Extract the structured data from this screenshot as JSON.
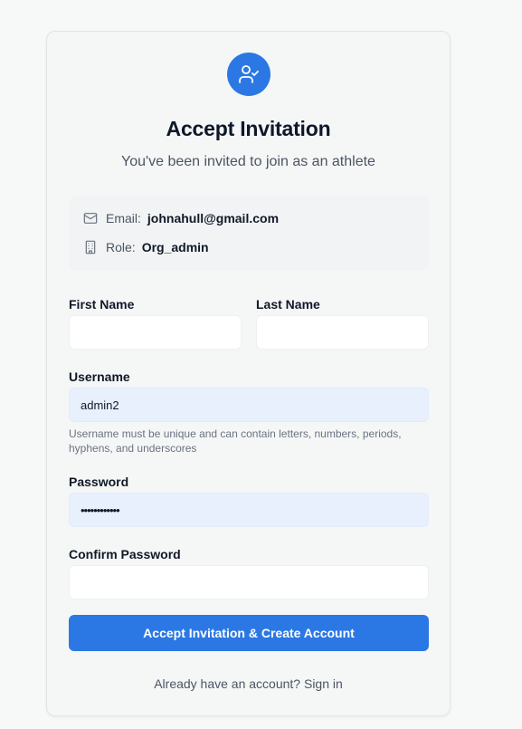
{
  "header": {
    "icon": "user-check-icon",
    "title": "Accept Invitation",
    "subtitle": "You've been invited to join as an athlete"
  },
  "invite_info": {
    "email_label": "Email:",
    "email_value": "johnahull@gmail.com",
    "email_icon": "mail-icon",
    "role_label": "Role:",
    "role_value": "Org_admin",
    "role_icon": "building-icon"
  },
  "form": {
    "first_name": {
      "label": "First Name",
      "value": ""
    },
    "last_name": {
      "label": "Last Name",
      "value": ""
    },
    "username": {
      "label": "Username",
      "value": "admin2",
      "hint": "Username must be unique and can contain letters, numbers, periods, hyphens, and underscores"
    },
    "password": {
      "label": "Password",
      "value": "••••••••••••"
    },
    "confirm_password": {
      "label": "Confirm Password",
      "value": ""
    },
    "submit_label": "Accept Invitation & Create Account"
  },
  "footer": {
    "prompt": "Already have an account?",
    "signin_label": "Sign in"
  },
  "colors": {
    "accent": "#2b78e4",
    "autofill_bg": "#e8f0fe"
  }
}
